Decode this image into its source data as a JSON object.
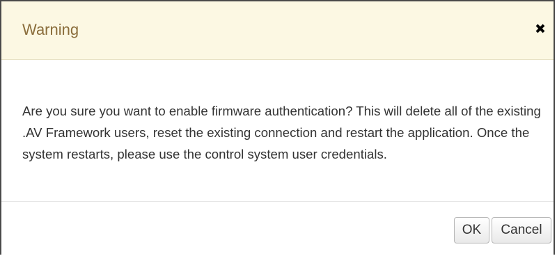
{
  "dialog": {
    "title": "Warning",
    "close_icon": "close-icon",
    "message": "Are you sure you want to enable firmware authentication? This will delete all of the existing .AV Framework users, reset the existing connection and restart the application. Once the system restarts, please use the control system user credentials.",
    "buttons": {
      "ok_label": "OK",
      "cancel_label": "Cancel"
    }
  },
  "colors": {
    "header_background": "#fcf8e3",
    "title_text": "#8a6d3b",
    "body_text": "#333333"
  }
}
